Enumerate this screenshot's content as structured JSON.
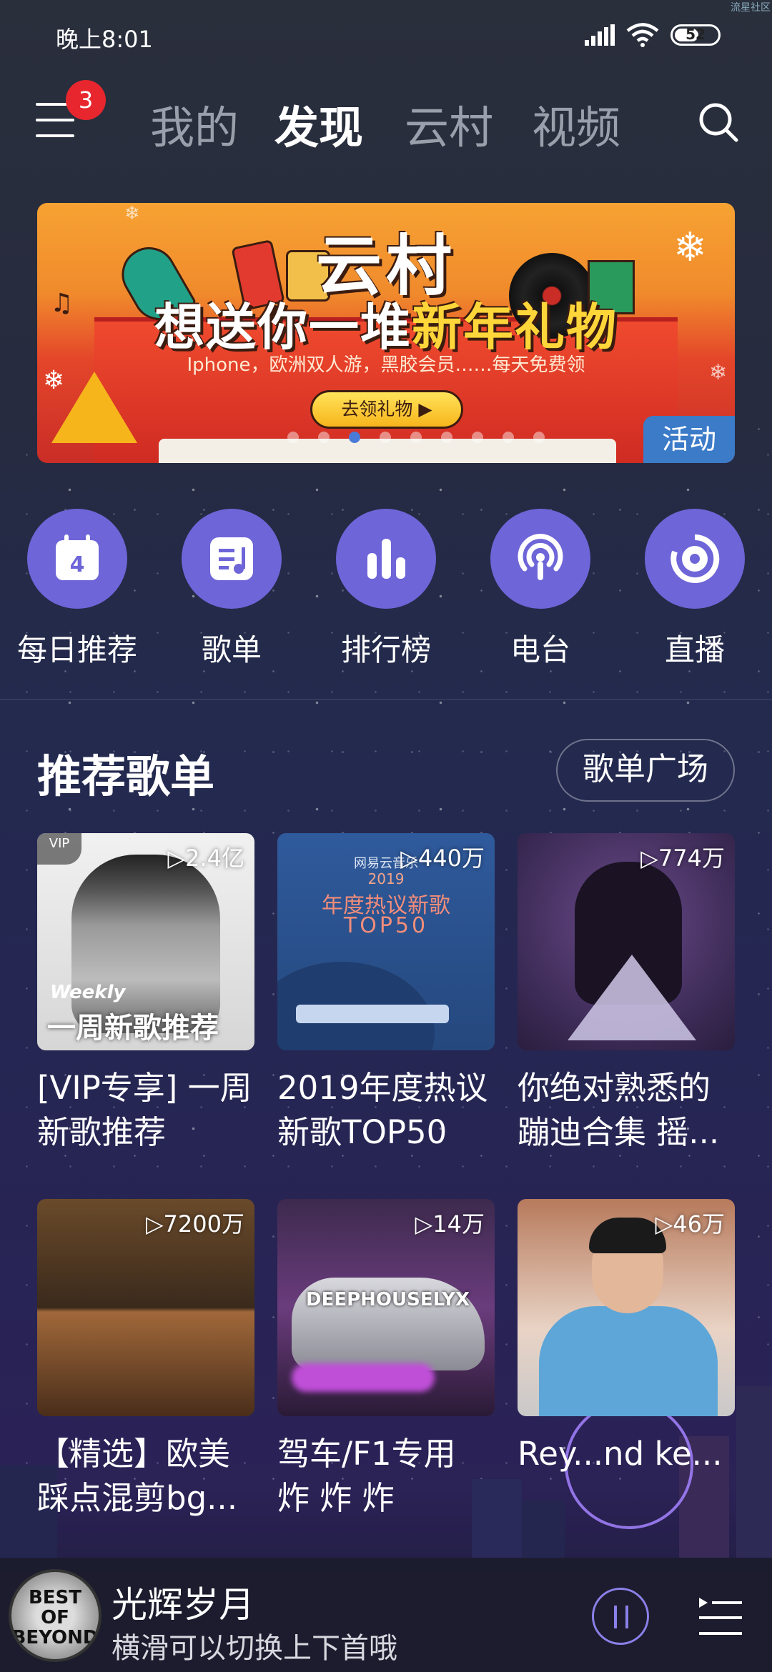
{
  "status": {
    "time": "晚上8:01",
    "battery": "52",
    "corner_text": "流星社区"
  },
  "nav": {
    "badge_count": "3",
    "tabs": [
      "我的",
      "发现",
      "云村",
      "视频"
    ],
    "active_tab": "发现"
  },
  "banner": {
    "title_line1": "云村",
    "title_line2_a": "想送你一堆",
    "title_line2_b": "新年礼物",
    "subtitle": "Iphone，欧洲双人游，黑胶会员……每天免费领",
    "button": "去领礼物 ▶",
    "tag": "活动",
    "dot_count": 9,
    "active_dot": 3
  },
  "shortcuts": [
    {
      "label": "每日推荐",
      "icon": "calendar-icon",
      "day": "4"
    },
    {
      "label": "歌单",
      "icon": "playlist-icon"
    },
    {
      "label": "排行榜",
      "icon": "chart-bars-icon"
    },
    {
      "label": "电台",
      "icon": "podcast-icon"
    },
    {
      "label": "直播",
      "icon": "live-disc-icon"
    }
  ],
  "section": {
    "title": "推荐歌单",
    "more_button": "歌单广场"
  },
  "playlists": [
    {
      "title": "[VIP专享] 一周新歌推荐",
      "plays": "▷2.4亿",
      "vip": "VIP",
      "cover_text_1": "Weekly",
      "cover_text_2": "一周新歌推荐"
    },
    {
      "title": "2019年度热议新歌TOP50",
      "plays": "▷440万",
      "cover_text_1": "网易云音乐",
      "cover_text_2": "2019",
      "cover_text_3": "年度热议新歌",
      "cover_text_4": "TOP50"
    },
    {
      "title": "你绝对熟悉的蹦迪合集 摇...",
      "plays": "▷774万"
    },
    {
      "title": "【精选】欧美踩点混剪bg...",
      "plays": "▷7200万"
    },
    {
      "title": "驾车/F1专用 炸 炸 炸",
      "plays": "▷14万",
      "cover_text_1": "DEEPHOUSELYX"
    },
    {
      "title": "Rey...nd ke...",
      "plays": "▷46万"
    }
  ],
  "player": {
    "song": "光辉岁月",
    "hint": "横滑可以切换上下首哦",
    "disc_text": "BEST OF BEYOND",
    "accent": "#8a80e8"
  }
}
